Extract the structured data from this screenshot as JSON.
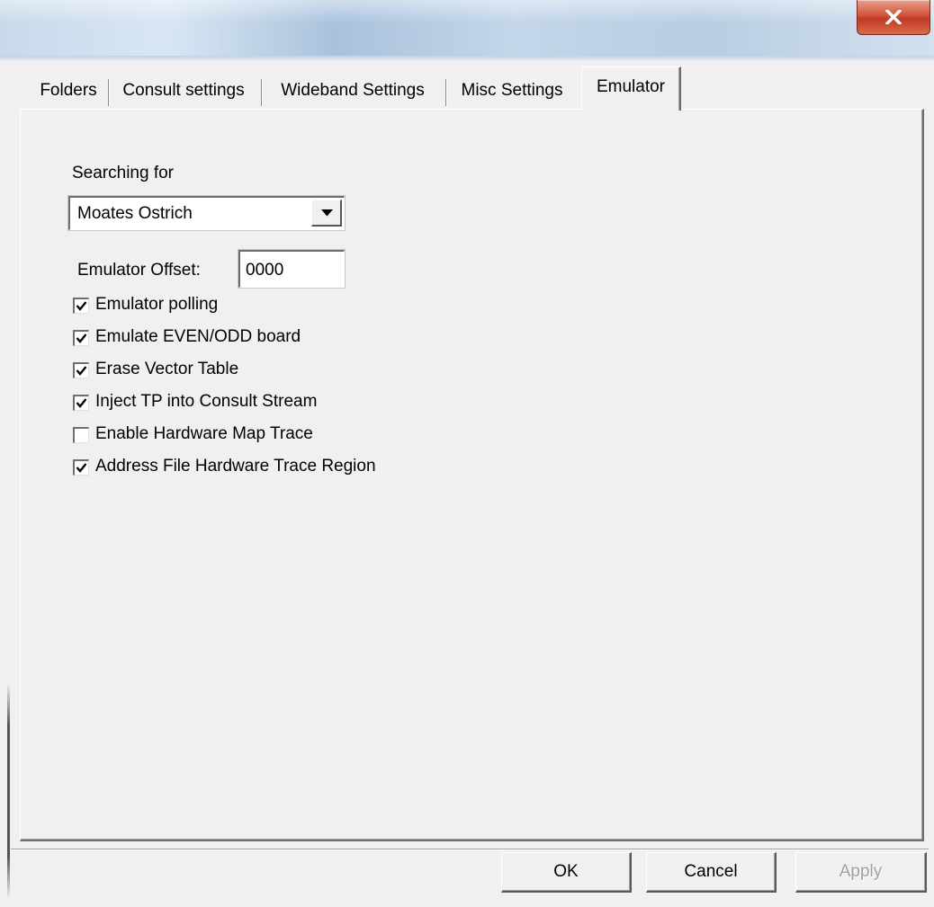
{
  "window": {
    "close_icon": "close-x-icon"
  },
  "tabs": [
    {
      "label": "Folders",
      "active": false
    },
    {
      "label": "Consult settings",
      "active": false
    },
    {
      "label": "Wideband Settings",
      "active": false
    },
    {
      "label": "Misc Settings",
      "active": false
    },
    {
      "label": "Emulator",
      "active": true
    }
  ],
  "emulator": {
    "searching_label": "Searching for",
    "device_selected": "Moates Ostrich",
    "dropdown_icon": "chevron-down-icon",
    "offset_label": "Emulator Offset:",
    "offset_value": "0000",
    "options": [
      {
        "label": "Emulator polling",
        "checked": true
      },
      {
        "label": "Emulate EVEN/ODD board",
        "checked": true
      },
      {
        "label": "Erase Vector Table",
        "checked": true
      },
      {
        "label": "Inject TP into Consult Stream",
        "checked": true
      },
      {
        "label": "Enable Hardware Map Trace",
        "checked": false
      },
      {
        "label": "Address File Hardware Trace Region",
        "checked": true
      }
    ]
  },
  "buttons": {
    "ok": "OK",
    "cancel": "Cancel",
    "apply": "Apply"
  }
}
